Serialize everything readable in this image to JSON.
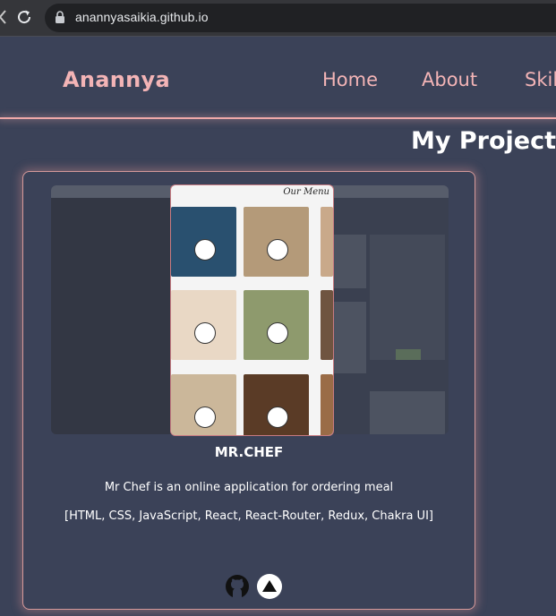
{
  "browser": {
    "url": "anannyasaikia.github.io",
    "icons": [
      "back-arrow-icon",
      "reload-icon",
      "lock-icon"
    ]
  },
  "header": {
    "brand": "Anannya",
    "nav": [
      {
        "label": "Home"
      },
      {
        "label": "About"
      },
      {
        "label": "Skil"
      }
    ]
  },
  "projects_section": {
    "title": "My Projects"
  },
  "project": {
    "name": "MR.CHEF",
    "description": "Mr Chef is an online application for ordering meal",
    "tech": "[HTML, CSS, JavaScript, React, React-Router, Redux, Chakra UI]",
    "preview_menu_label": "Our Menu",
    "links": [
      "github-icon",
      "deploy-icon"
    ]
  },
  "colors": {
    "background": "#3b4258",
    "accent_pink": "#f3b4b6",
    "text": "#ffffff",
    "browser_chrome": "#35363a"
  }
}
